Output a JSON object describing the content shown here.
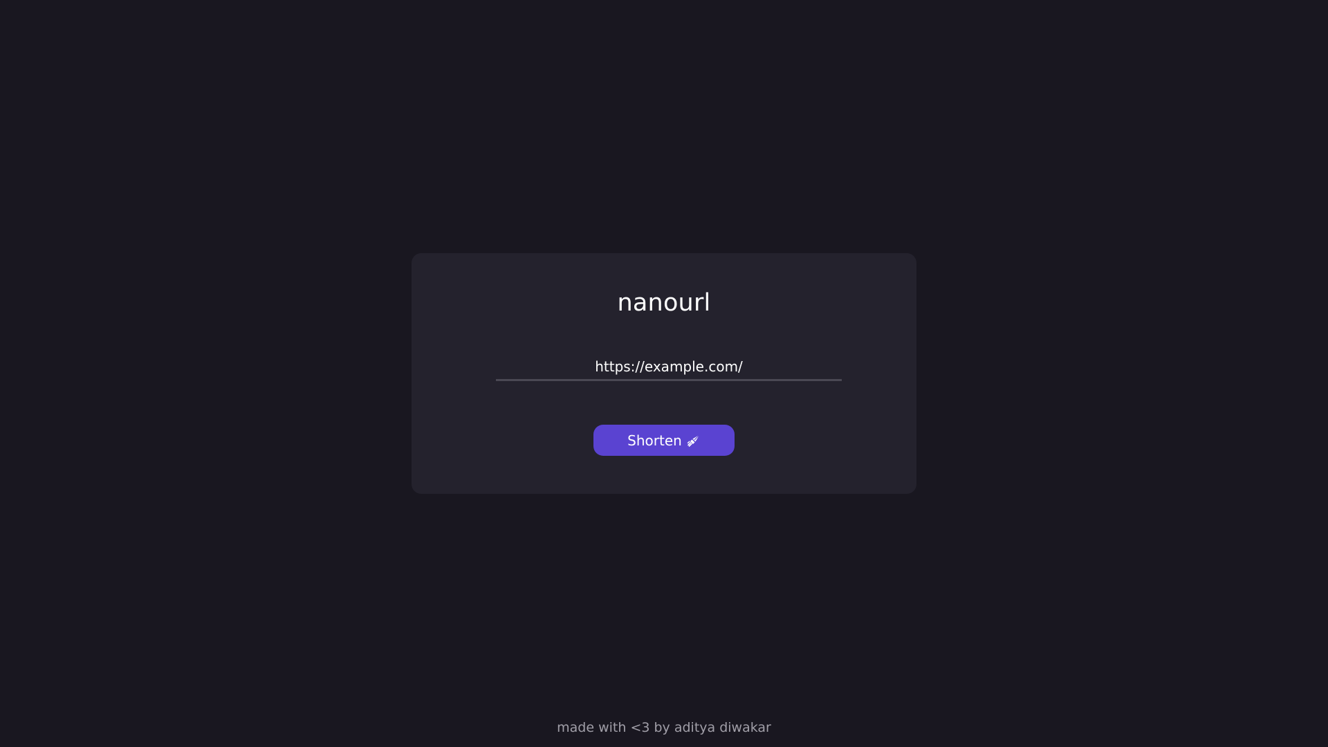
{
  "app": {
    "title": "nanourl"
  },
  "form": {
    "url_value": "https://example.com/",
    "shorten_label": "Shorten",
    "button_icon": "rocket-icon"
  },
  "footer": {
    "text": "made with <3 by aditya diwakar"
  },
  "colors": {
    "background": "#191720",
    "card": "#24222d",
    "accent": "#5a43d1",
    "input_underline": "#4a4853",
    "footer_text": "#a19fa8"
  }
}
